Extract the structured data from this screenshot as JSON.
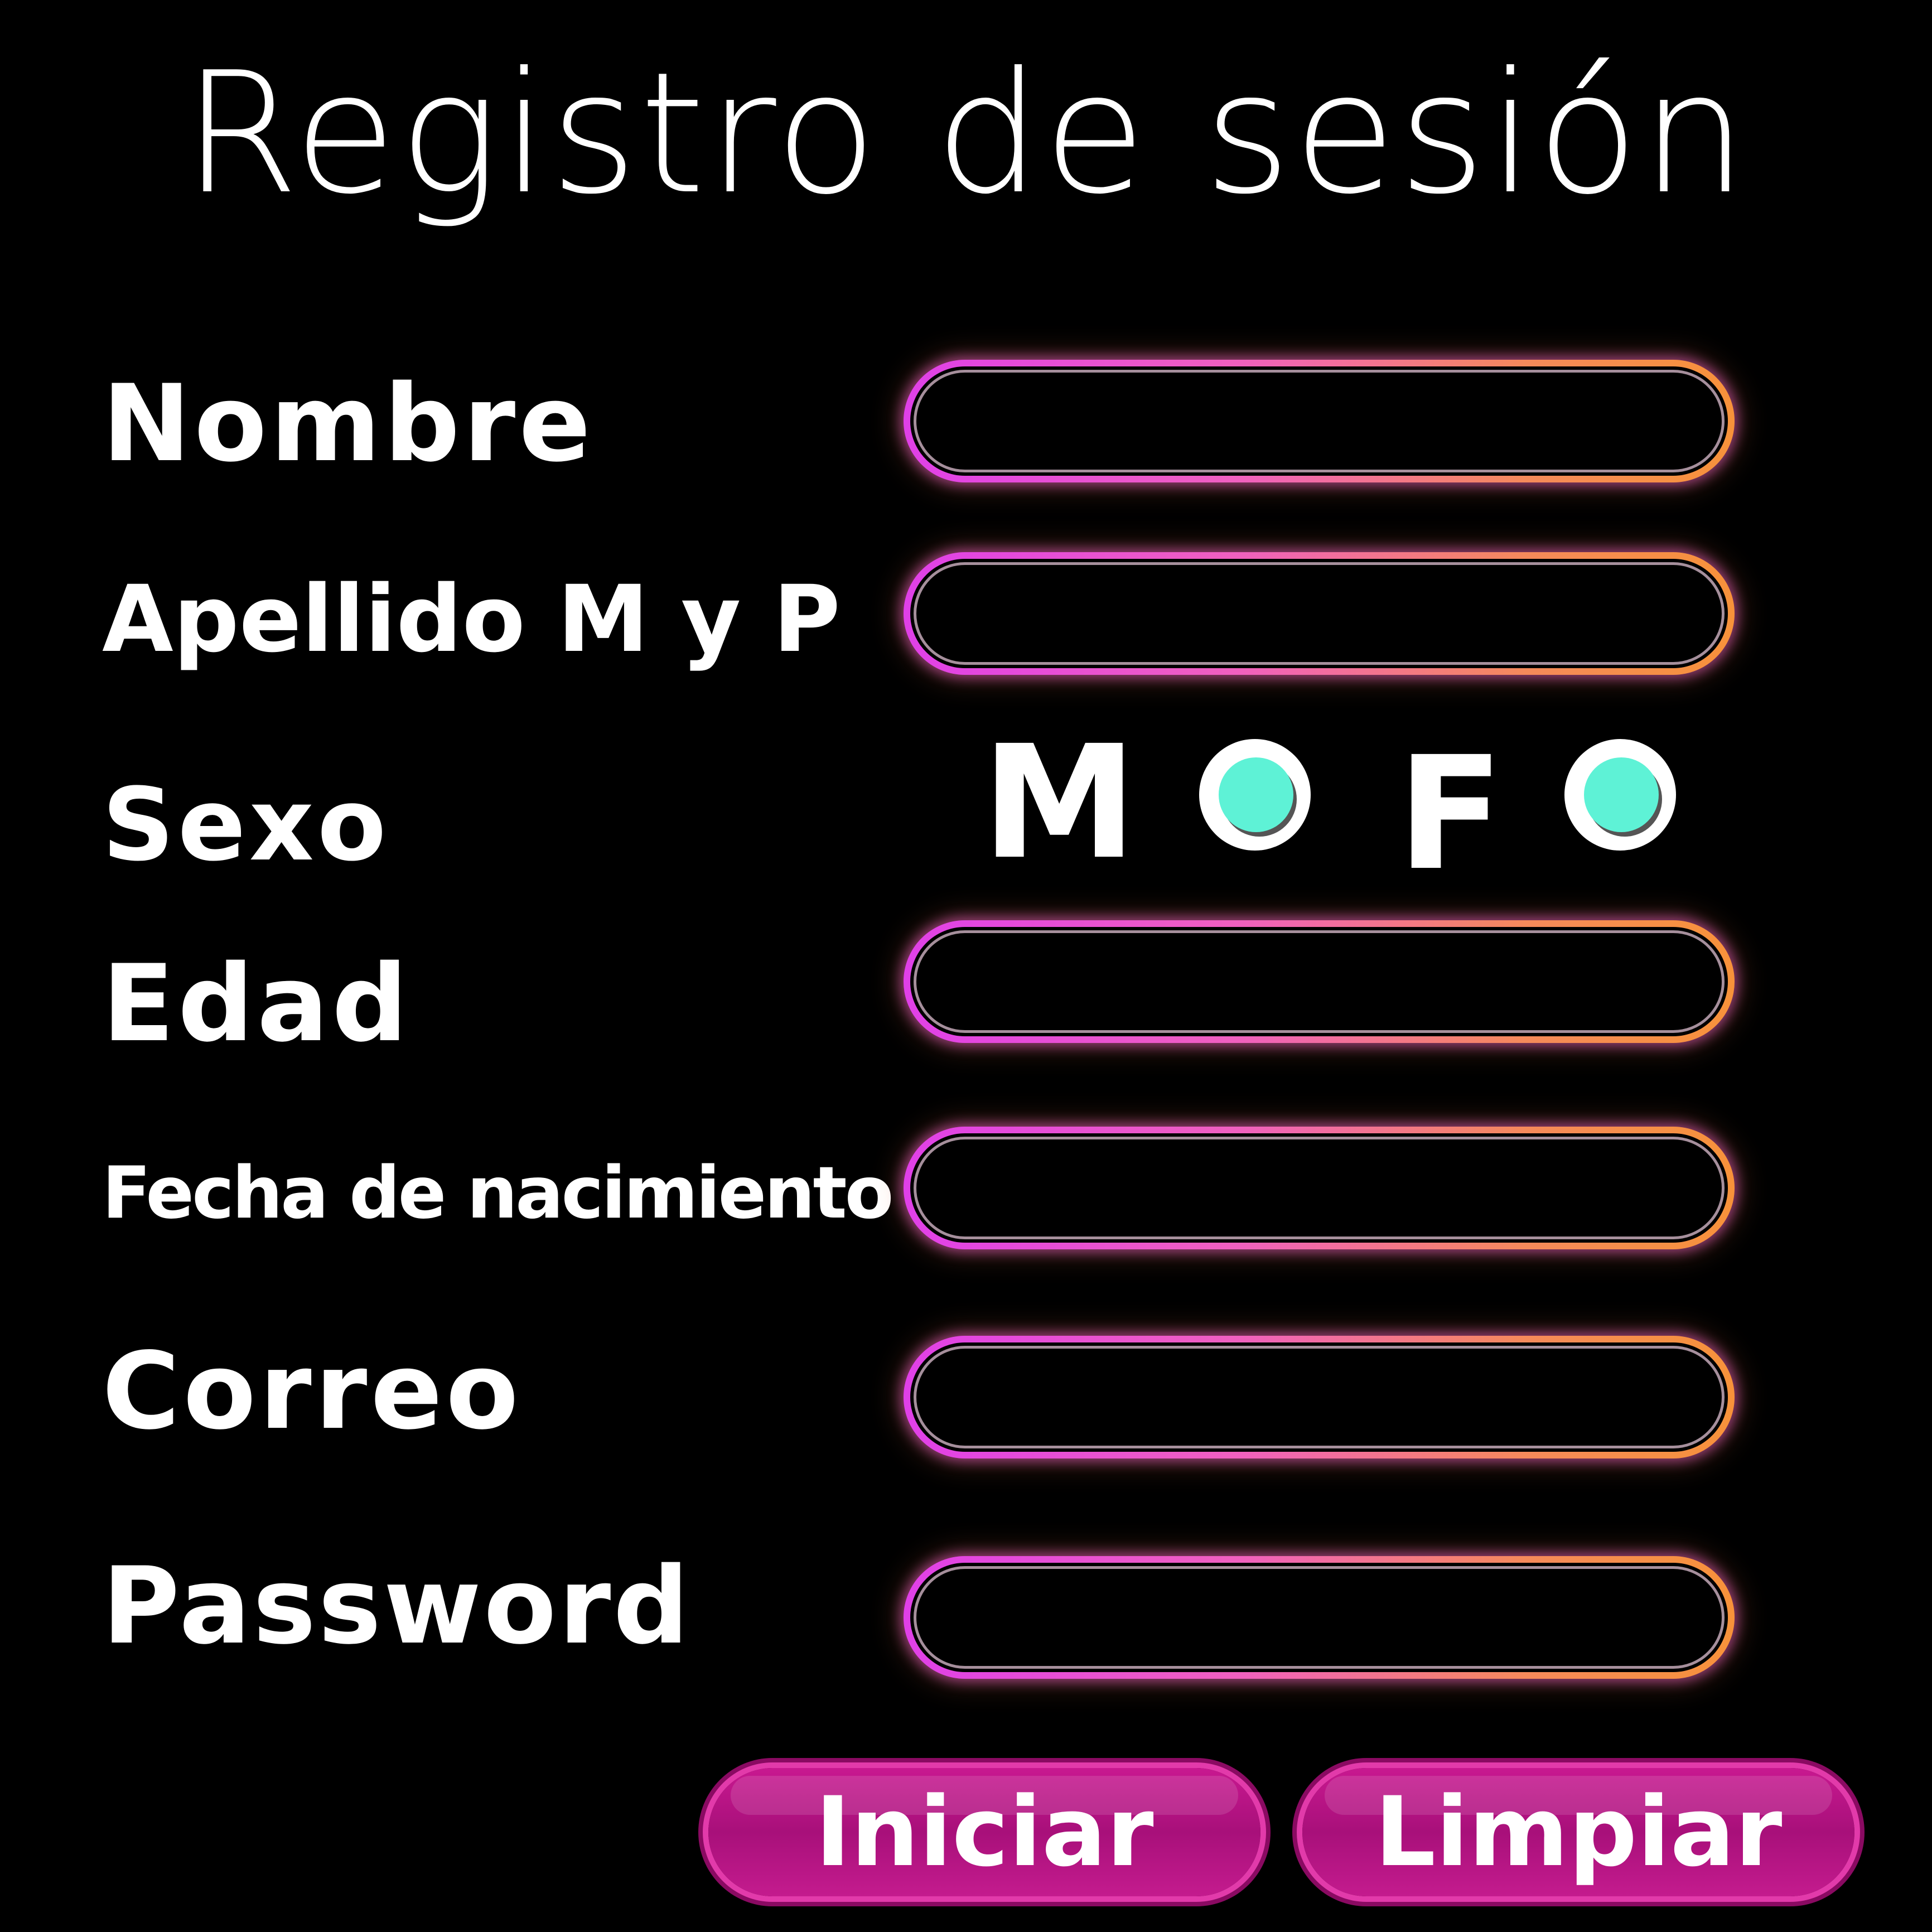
{
  "title": "Registro de sesión",
  "form": {
    "nombre_label": "Nombre",
    "nombre_value": "",
    "apellido_label": "Apellido M y P",
    "apellido_value": "",
    "sexo_label": "Sexo",
    "sexo_options": [
      "M",
      "F"
    ],
    "edad_label": "Edad",
    "edad_value": "",
    "fecha_label": "Fecha de nacimiento",
    "fecha_value": "",
    "correo_label": "Correo",
    "correo_value": "",
    "password_label": "Password",
    "password_value": ""
  },
  "buttons": {
    "iniciar": "Iniciar",
    "limpiar": "Limpiar"
  },
  "colors": {
    "background": "#000000",
    "field_glow_left": "#e040e8",
    "field_glow_right": "#f7923a",
    "radio_dot": "#5ef2d6",
    "button": "#b8127f"
  }
}
